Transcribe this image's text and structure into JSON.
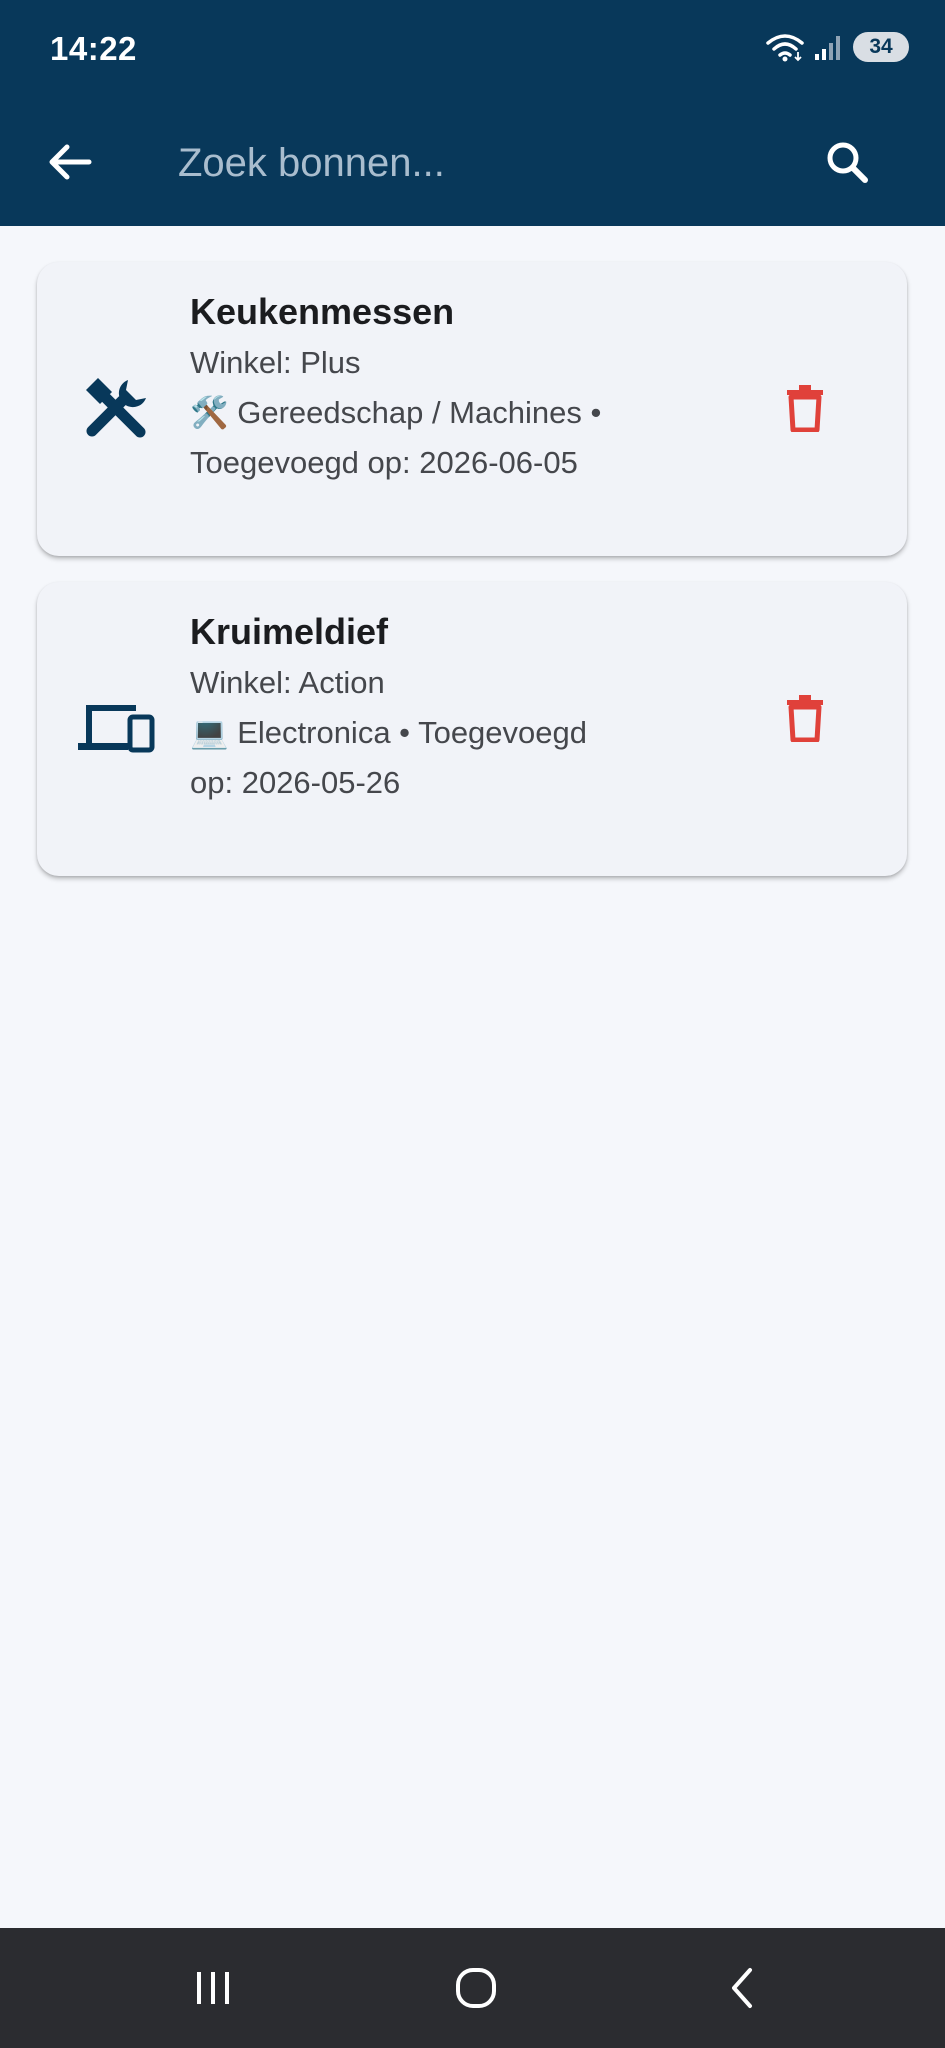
{
  "status_bar": {
    "time": "14:22",
    "battery": "34"
  },
  "app_bar": {
    "search_placeholder": "Zoek bonnen...",
    "back_icon": "arrow-left-icon",
    "search_icon": "search-icon",
    "background_color": "#08385A"
  },
  "receipts": [
    {
      "title": "Keukenmessen",
      "store": "Winkel: Plus",
      "category_line_1": "🛠️ Gereedschap / Machines •",
      "category_line_2": "Toegevoegd op: 2026-06-05",
      "icon": "tools-icon"
    },
    {
      "title": "Kruimeldief",
      "store": "Winkel: Action",
      "category_line_1": "💻 Electronica • Toegevoegd",
      "category_line_2": "op: 2026-05-26",
      "icon": "devices-icon"
    }
  ],
  "colors": {
    "primary": "#08385A",
    "delete": "#E0413A",
    "background": "#F5F7FB",
    "card": "#F1F3F8"
  }
}
